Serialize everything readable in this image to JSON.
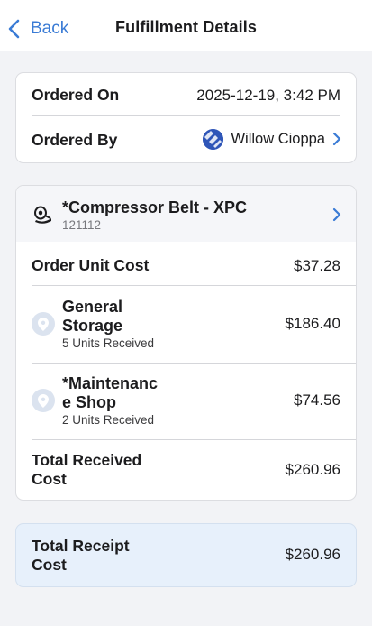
{
  "nav": {
    "back_label": "Back",
    "title": "Fulfillment Details"
  },
  "order": {
    "ordered_on_label": "Ordered On",
    "ordered_on_value": "2025-12-19, 3:42 PM",
    "ordered_by_label": "Ordered By",
    "ordered_by_name": "Willow Cioppa"
  },
  "item": {
    "name": "*Compressor Belt - XPC",
    "number": "121112",
    "icon": "compressor-belt-icon"
  },
  "costs": {
    "order_unit_cost_label": "Order Unit Cost",
    "order_unit_cost_value": "$37.28",
    "locations": [
      {
        "name": "General Storage",
        "units": "5 Units Received",
        "cost": "$186.40",
        "icon": "location-pin-icon"
      },
      {
        "name": "*Maintenance Shop",
        "units": "2 Units Received",
        "cost": "$74.56",
        "icon": "location-pin-icon"
      }
    ],
    "total_received_label": "Total Received Cost",
    "total_received_value": "$260.96"
  },
  "receipt": {
    "label": "Total Receipt Cost",
    "value": "$260.96"
  },
  "colors": {
    "accent": "#3a7bd5",
    "receipt_bg": "#e7f0fb",
    "page_bg": "#f2f3f6"
  }
}
